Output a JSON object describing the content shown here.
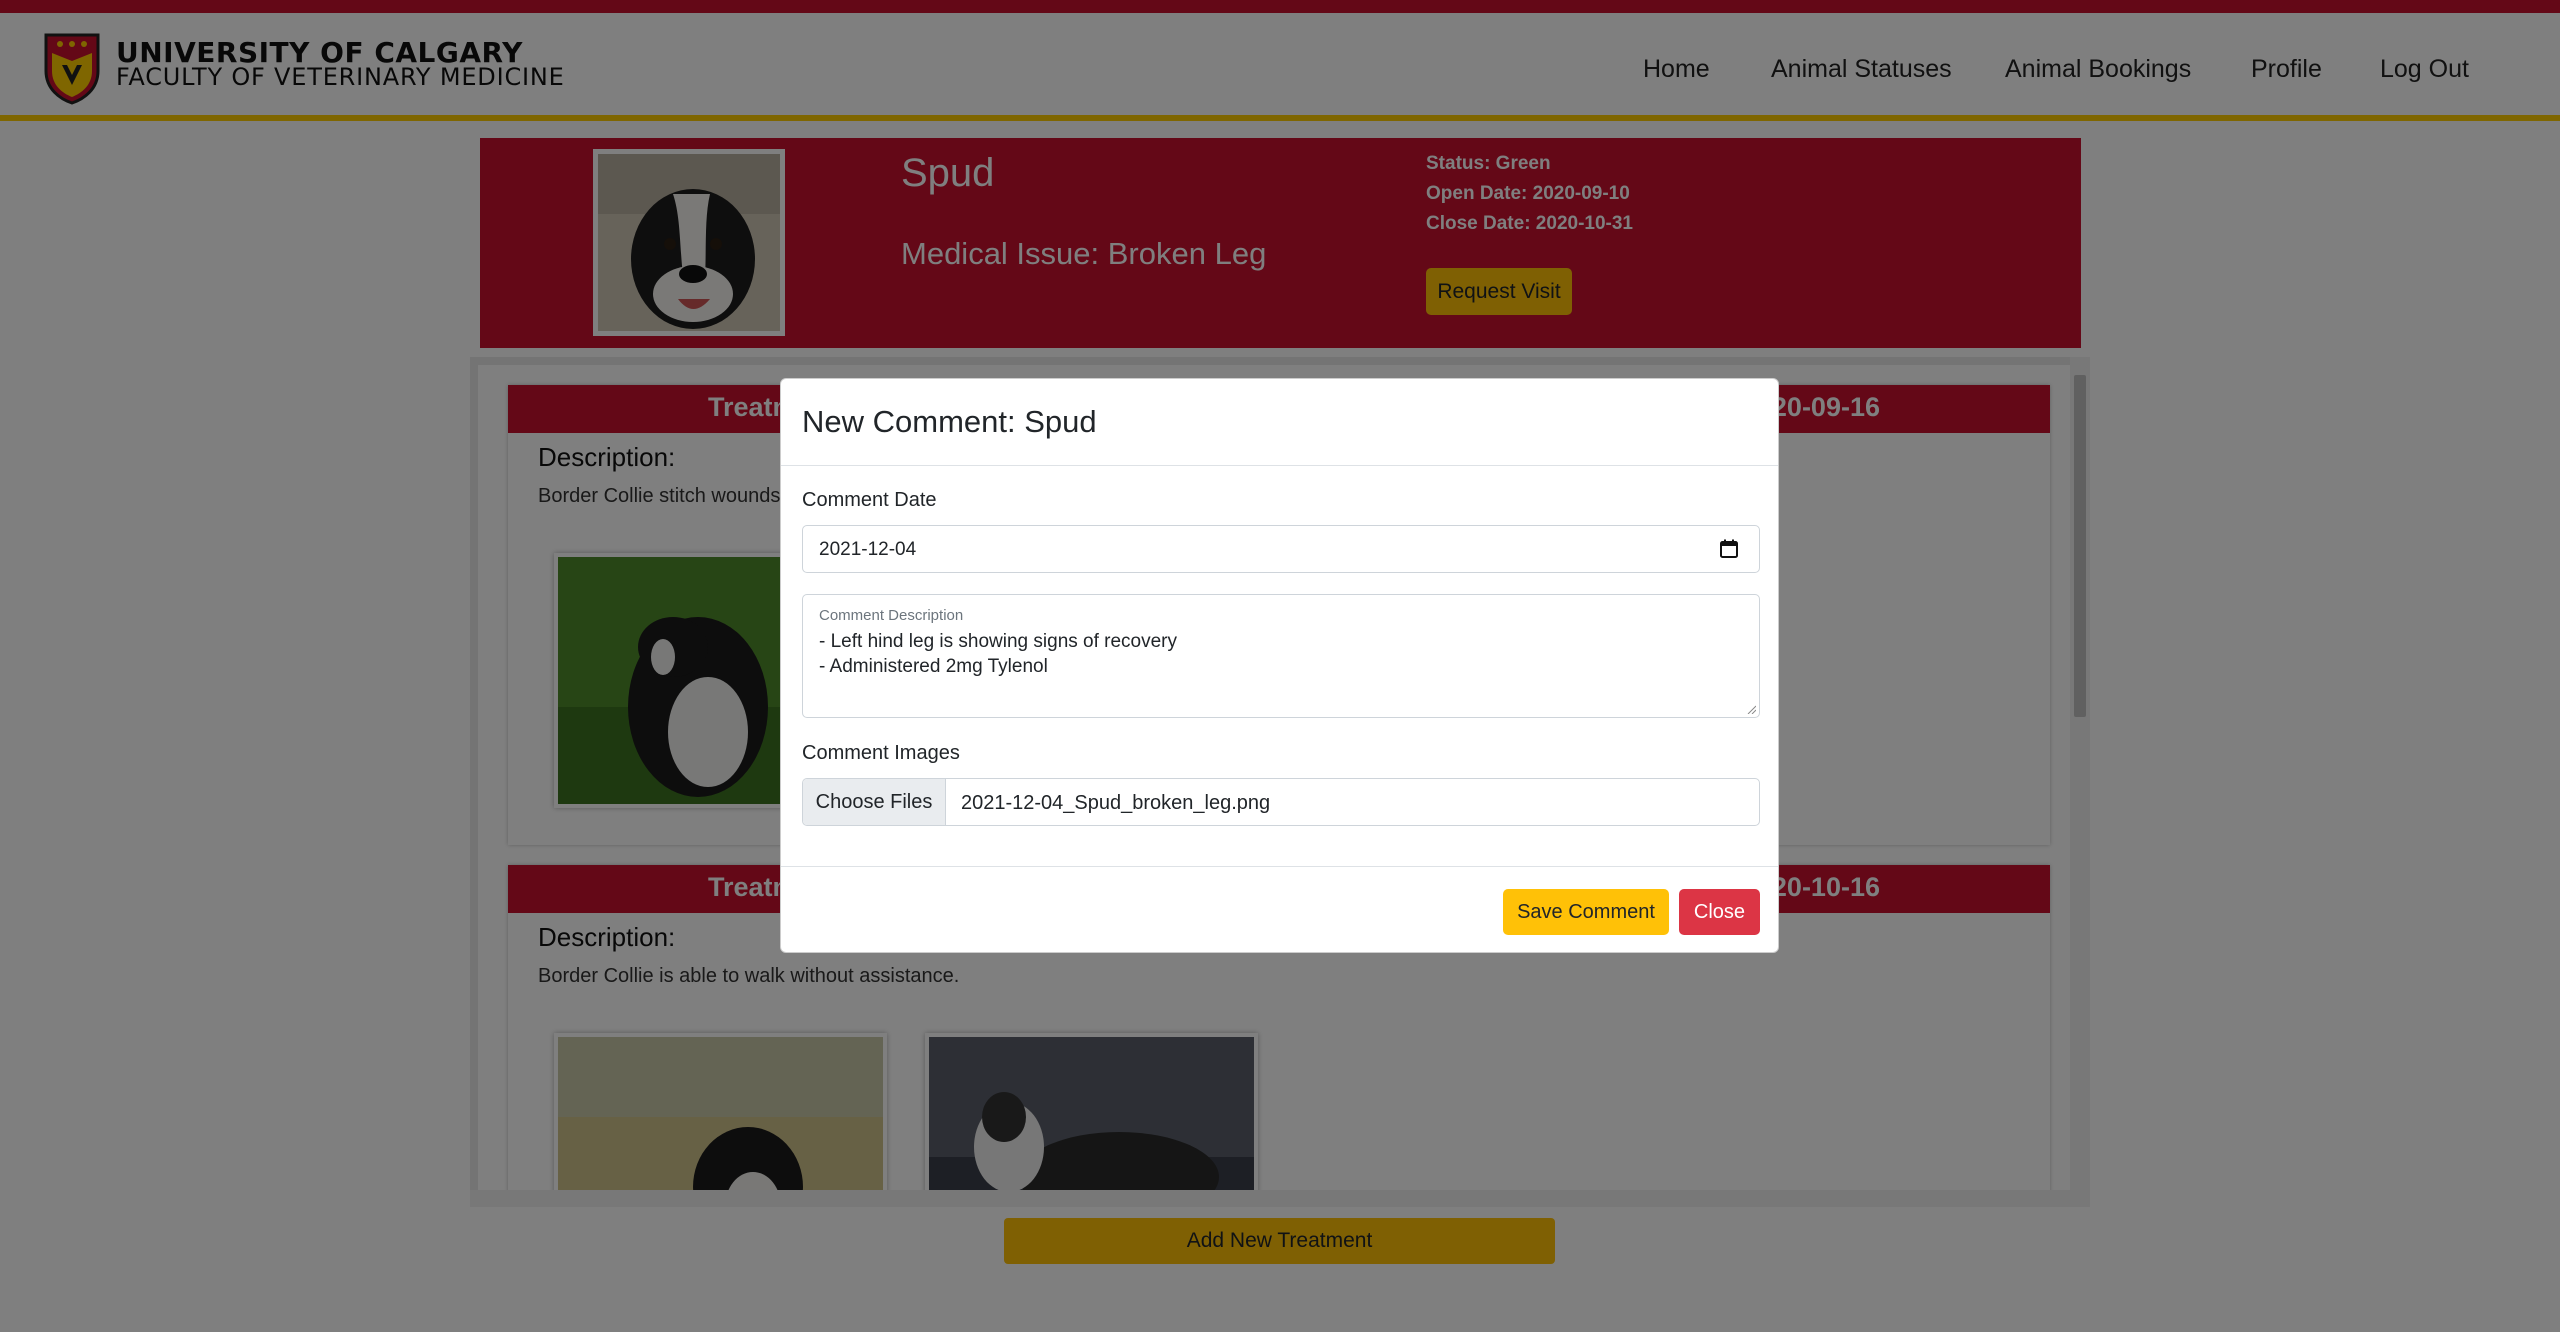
{
  "brand": {
    "line1": "UNIVERSITY OF CALGARY",
    "line2": "FACULTY OF VETERINARY MEDICINE"
  },
  "nav": {
    "items": [
      "Home",
      "Animal Statuses",
      "Animal Bookings",
      "Profile",
      "Log Out"
    ]
  },
  "animal": {
    "name": "Spud",
    "medical_issue": "Medical Issue: Broken Leg",
    "status": "Status: Green",
    "open_date": "Open Date: 2020-09-10",
    "close_date": "Close Date: 2020-10-31",
    "request_visit_label": "Request Visit"
  },
  "treatments": [
    {
      "title_visible": "Treatm",
      "date_visible": "20-09-16",
      "description_label": "Description:",
      "description_visible": "Border Collie stitch wounds s"
    },
    {
      "title_visible": "Treatm",
      "date_visible": "20-10-16",
      "description_label": "Description:",
      "description_visible": "Border Collie is able to walk without assistance."
    }
  ],
  "add_treatment_label": "Add New Treatment",
  "modal": {
    "title": "New Comment: Spud",
    "date_label": "Comment Date",
    "date_value": "2021-12-04",
    "description_float_label": "Comment Description",
    "description_lines": [
      "- Left hind leg is showing signs of recovery",
      "- Administered 2mg Tylenol"
    ],
    "images_label": "Comment Images",
    "choose_files_label": "Choose Files",
    "file_name": "2021-12-04_Spud_broken_leg.png",
    "save_label": "Save Comment",
    "close_label": "Close"
  },
  "colors": {
    "brand_red": "#c8102e",
    "brand_gold": "#ffcd00",
    "button_yellow": "#ffc107",
    "button_danger": "#dc3545"
  }
}
